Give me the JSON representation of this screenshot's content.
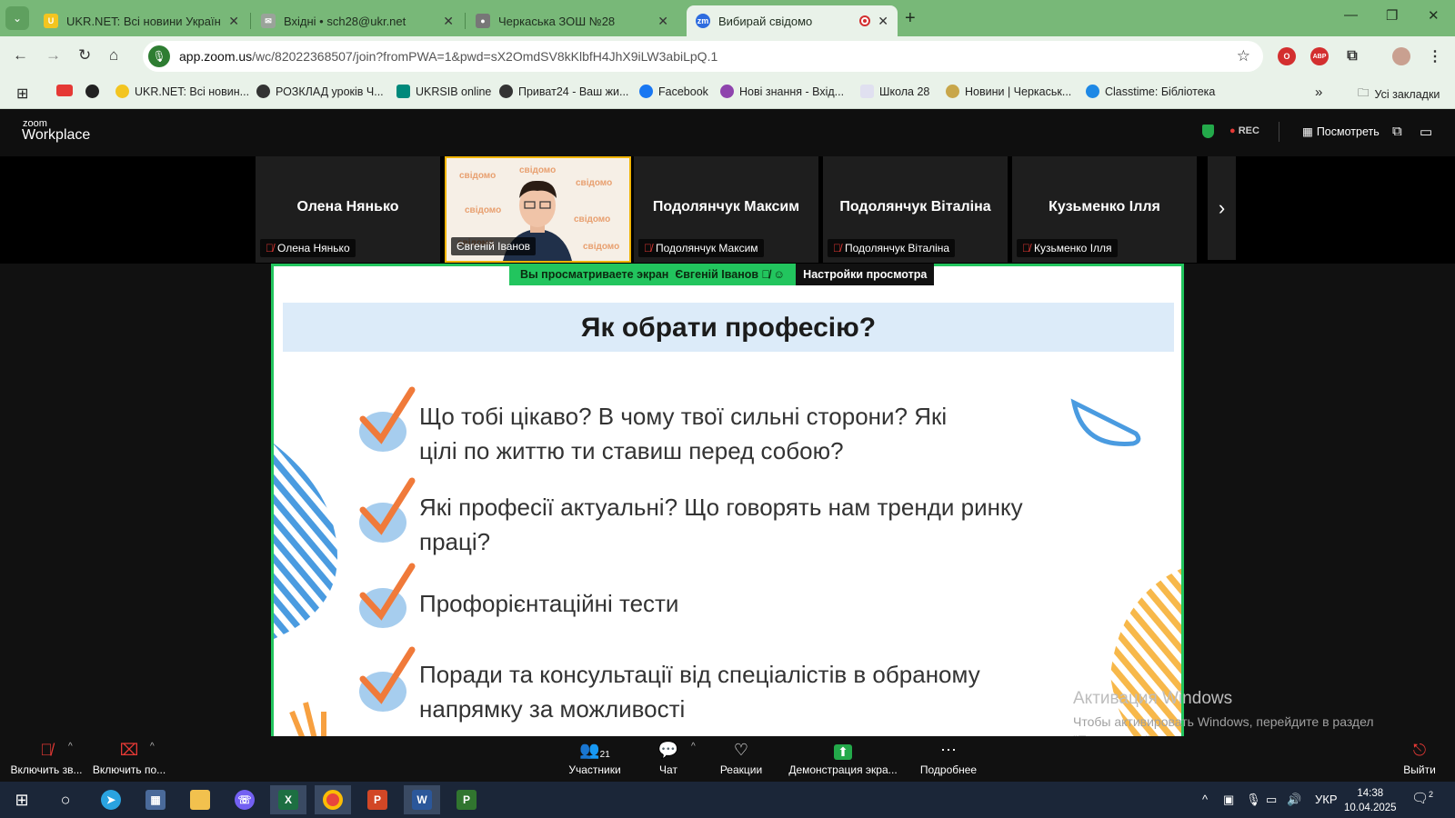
{
  "browser": {
    "tabs": [
      {
        "title": "UKR.NET: Всі новини України, ...",
        "color": "#f3c520",
        "glyph": "U"
      },
      {
        "title": "Вхідні • sch28@ukr.net",
        "color": "#9aa39a",
        "glyph": "✉"
      },
      {
        "title": "Черкаська ЗОШ №28",
        "color": "#777777",
        "glyph": "●"
      },
      {
        "title": "Вибирай свідомо",
        "color": "#2d6cdf",
        "glyph": "zm"
      }
    ],
    "new_tab": "+",
    "url_host": "app.zoom.us",
    "url_path": "/wc/82022368507/join?fromPWA=1&pwd=sX2OmdSV8kKlbfH4JhX9iLW3abiLpQ.1",
    "bookmarks": [
      "UKR.NET: Всі новин...",
      "РОЗКЛАД уроків Ч...",
      "UKRSIB online",
      "Приват24 - Ваш жи...",
      "Facebook",
      "Нові знання - Вхід...",
      "Школа 28",
      "Новини | Черкаськ...",
      "Classtime: Бібліотека"
    ],
    "all_bookmarks": "Усі закладки"
  },
  "zoom": {
    "logo_top": "zoom",
    "logo_bottom": "Workplace",
    "rec": "REC",
    "view_button": "Посмотреть",
    "participants": [
      {
        "name": "Олена Нянько",
        "label": "Олена Нянько",
        "video": false
      },
      {
        "name": "Євгеній Іванов",
        "label": "Євгеній Іванов",
        "video": true
      },
      {
        "name": "Подолянчук Максим",
        "label": "Подолянчук Максим",
        "video": false
      },
      {
        "name": "Подолянчук Віталіна",
        "label": "Подолянчук Віталіна",
        "video": false
      },
      {
        "name": "Кузьменко Ілля",
        "label": "Кузьменко Ілля",
        "video": false
      }
    ],
    "share_banner": "Вы просматриваете экран",
    "share_owner": "Євгеній Іванов",
    "view_settings": "Настройки просмотра",
    "bottom": {
      "mic": "Включить зв...",
      "camera": "Включить по...",
      "participants": "Участники",
      "participants_count": "21",
      "chat": "Чат",
      "reactions": "Реакции",
      "share": "Демонстрация экра...",
      "more": "Подробнее",
      "leave": "Выйти"
    }
  },
  "slide": {
    "title": "Як обрати професію?",
    "bullets": [
      [
        "Що тобі цікаво? В чому твої сильні сторони? Які",
        "цілі по життю ти ставиш перед собою?"
      ],
      [
        "Які професії актуальні? Що говорять нам тренди ринку",
        "праці?"
      ],
      [
        "Профорієнтаційні тести"
      ],
      [
        "Поради та консультації від спеціалістів в обраному",
        "напрямку за можливості"
      ]
    ]
  },
  "watermark": {
    "line1": "Активация Windows",
    "line2": "Чтобы активировать Windows, перейдите в раздел \"Параметры\"."
  },
  "taskbar": {
    "lang": "УКР",
    "time": "14:38",
    "date": "10.04.2025",
    "notifications": "2"
  }
}
